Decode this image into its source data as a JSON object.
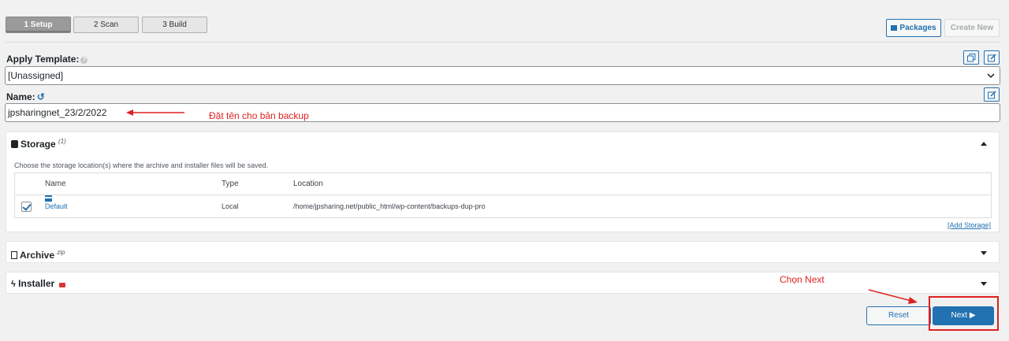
{
  "steps": [
    {
      "label": "1 Setup",
      "active": true
    },
    {
      "label": "2 Scan",
      "active": false
    },
    {
      "label": "3 Build",
      "active": false
    }
  ],
  "header": {
    "packages_label": "Packages",
    "create_new_label": "Create New"
  },
  "template": {
    "label": "Apply Template:",
    "help": "?",
    "selected": "[Unassigned]"
  },
  "name": {
    "label": "Name:",
    "value": "jpsharingnet_23/2/2022"
  },
  "annotations": {
    "name_note": "Đặt tên cho bản backup",
    "next_note": "Chọn Next",
    "color": "#e02020"
  },
  "storage": {
    "title": "Storage",
    "count": "(1)",
    "description": "Choose the storage location(s) where the archive and installer files will be saved.",
    "columns": [
      "Name",
      "Type",
      "Location"
    ],
    "rows": [
      {
        "checked": true,
        "name": "Default",
        "type": "Local",
        "location": "/home/jpsharing.net/public_html/wp-content/backups-dup-pro"
      }
    ],
    "add_link": "[Add Storage]"
  },
  "archive": {
    "title": "Archive",
    "badge": "zip"
  },
  "installer": {
    "title": "Installer"
  },
  "footer": {
    "reset_label": "Reset",
    "next_label": "Next ▶"
  },
  "colors": {
    "accent": "#2271b1",
    "background": "#f1f1f1"
  }
}
